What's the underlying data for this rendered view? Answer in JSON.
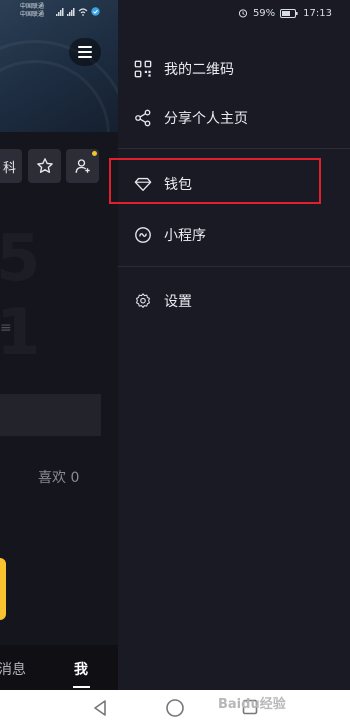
{
  "status_bar": {
    "carrier_line1": "中国联通",
    "carrier_line2": "中国联通",
    "battery": "59%",
    "time": "17:13"
  },
  "profile": {
    "follow_partial": "科",
    "likes": "喜欢 0"
  },
  "bottom_nav": {
    "messages": "消息",
    "me": "我"
  },
  "drawer": {
    "items": [
      {
        "label": "我的二维码",
        "icon": "qr-code-icon"
      },
      {
        "label": "分享个人主页",
        "icon": "share-icon"
      },
      {
        "label": "钱包",
        "icon": "wallet-diamond-icon",
        "highlighted": true
      },
      {
        "label": "小程序",
        "icon": "mini-program-icon"
      },
      {
        "label": "设置",
        "icon": "settings-gear-icon"
      }
    ]
  },
  "colors": {
    "drawer_bg": "#1a1a24",
    "highlight": "#e0202a",
    "accent_yellow": "#f8c32f"
  },
  "watermark": "Baidu经验"
}
